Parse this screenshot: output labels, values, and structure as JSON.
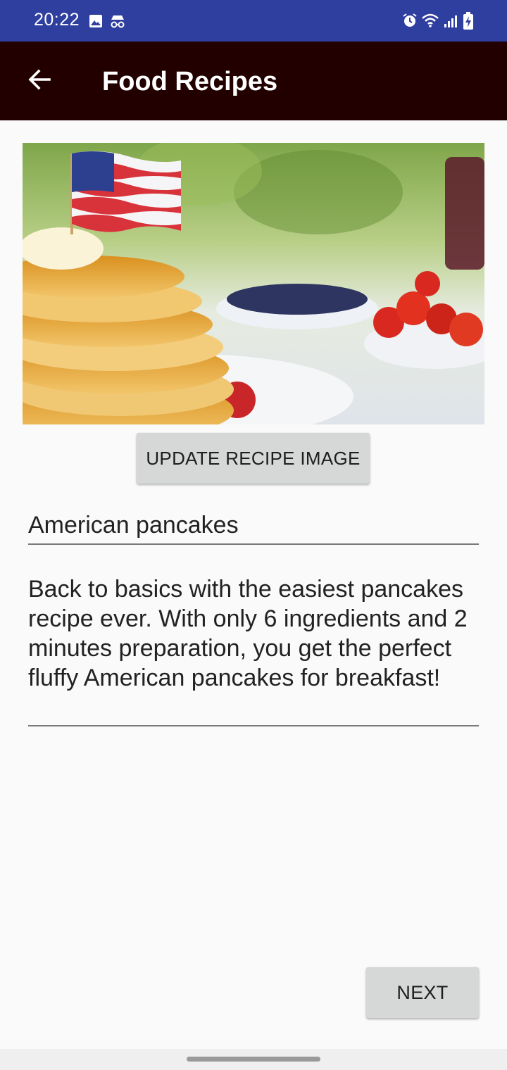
{
  "status_bar": {
    "time": "20:22",
    "left_icons": [
      "image-icon",
      "incognito-icon"
    ],
    "right_icons": [
      "alarm-icon",
      "wifi-icon",
      "signal-icon",
      "battery-charging-icon"
    ]
  },
  "app_bar": {
    "back_icon": "arrow-left-icon",
    "title": "Food Recipes",
    "background": "#220000"
  },
  "recipe": {
    "image": "american-pancakes-photo",
    "update_image_label": "Update Recipe Image",
    "title_value": "American pancakes",
    "description_value": "Back to basics with the easiest pancakes recipe ever. With only 6 ingredients and 2 minutes preparation, you get the perfect fluffy American pancakes for breakfast!"
  },
  "actions": {
    "next_label": "Next"
  },
  "colors": {
    "status_bar": "#2f3f9f",
    "button_bg": "#d6d7d7",
    "page_bg": "#fafafa"
  }
}
